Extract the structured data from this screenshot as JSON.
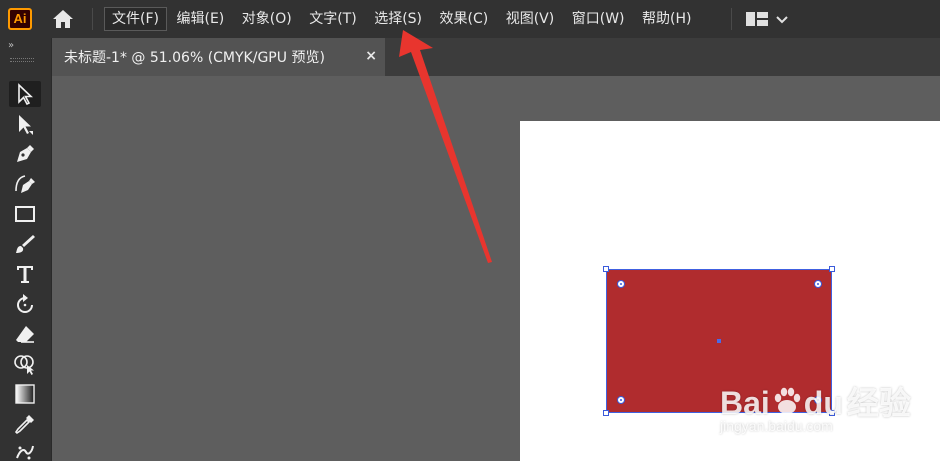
{
  "app": {
    "logo_text": "Ai",
    "accent_color": "#ff9a00"
  },
  "menu": {
    "items": [
      {
        "label": "文件(F)",
        "active": true
      },
      {
        "label": "编辑(E)"
      },
      {
        "label": "对象(O)"
      },
      {
        "label": "文字(T)"
      },
      {
        "label": "选择(S)"
      },
      {
        "label": "效果(C)"
      },
      {
        "label": "视图(V)"
      },
      {
        "label": "窗口(W)"
      },
      {
        "label": "帮助(H)"
      }
    ]
  },
  "icons": {
    "home": "home-icon",
    "workspace": "workspace-layout-icon",
    "chevron": "chevron-down-icon",
    "close": "close-icon"
  },
  "document_tab": {
    "title": "未标题-1* @ 51.06% (CMYK/GPU 预览)",
    "close_label": "×"
  },
  "toolbar": {
    "collapse_label": "»",
    "tools": [
      "selection-tool",
      "direct-selection-tool",
      "pen-tool",
      "curvature-tool",
      "rectangle-tool",
      "paintbrush-tool",
      "type-tool",
      "rotate-tool",
      "eraser-tool",
      "shape-builder-tool",
      "gradient-tool",
      "eyedropper-tool",
      "symbol-sprayer-tool"
    ],
    "selected_tool": "selection-tool"
  },
  "canvas": {
    "background_color": "#5e5e5e",
    "artboard_color": "#ffffff",
    "shape": {
      "type": "rectangle",
      "fill_color": "#b02c2e",
      "selected": true
    }
  },
  "annotation": {
    "arrow_color": "#e8352e",
    "points_to": "选择(S)"
  },
  "watermark": {
    "brand": "Bai",
    "brand_suffix": "du",
    "brand_cn": "经验",
    "url": "jingyan.baidu.com"
  }
}
